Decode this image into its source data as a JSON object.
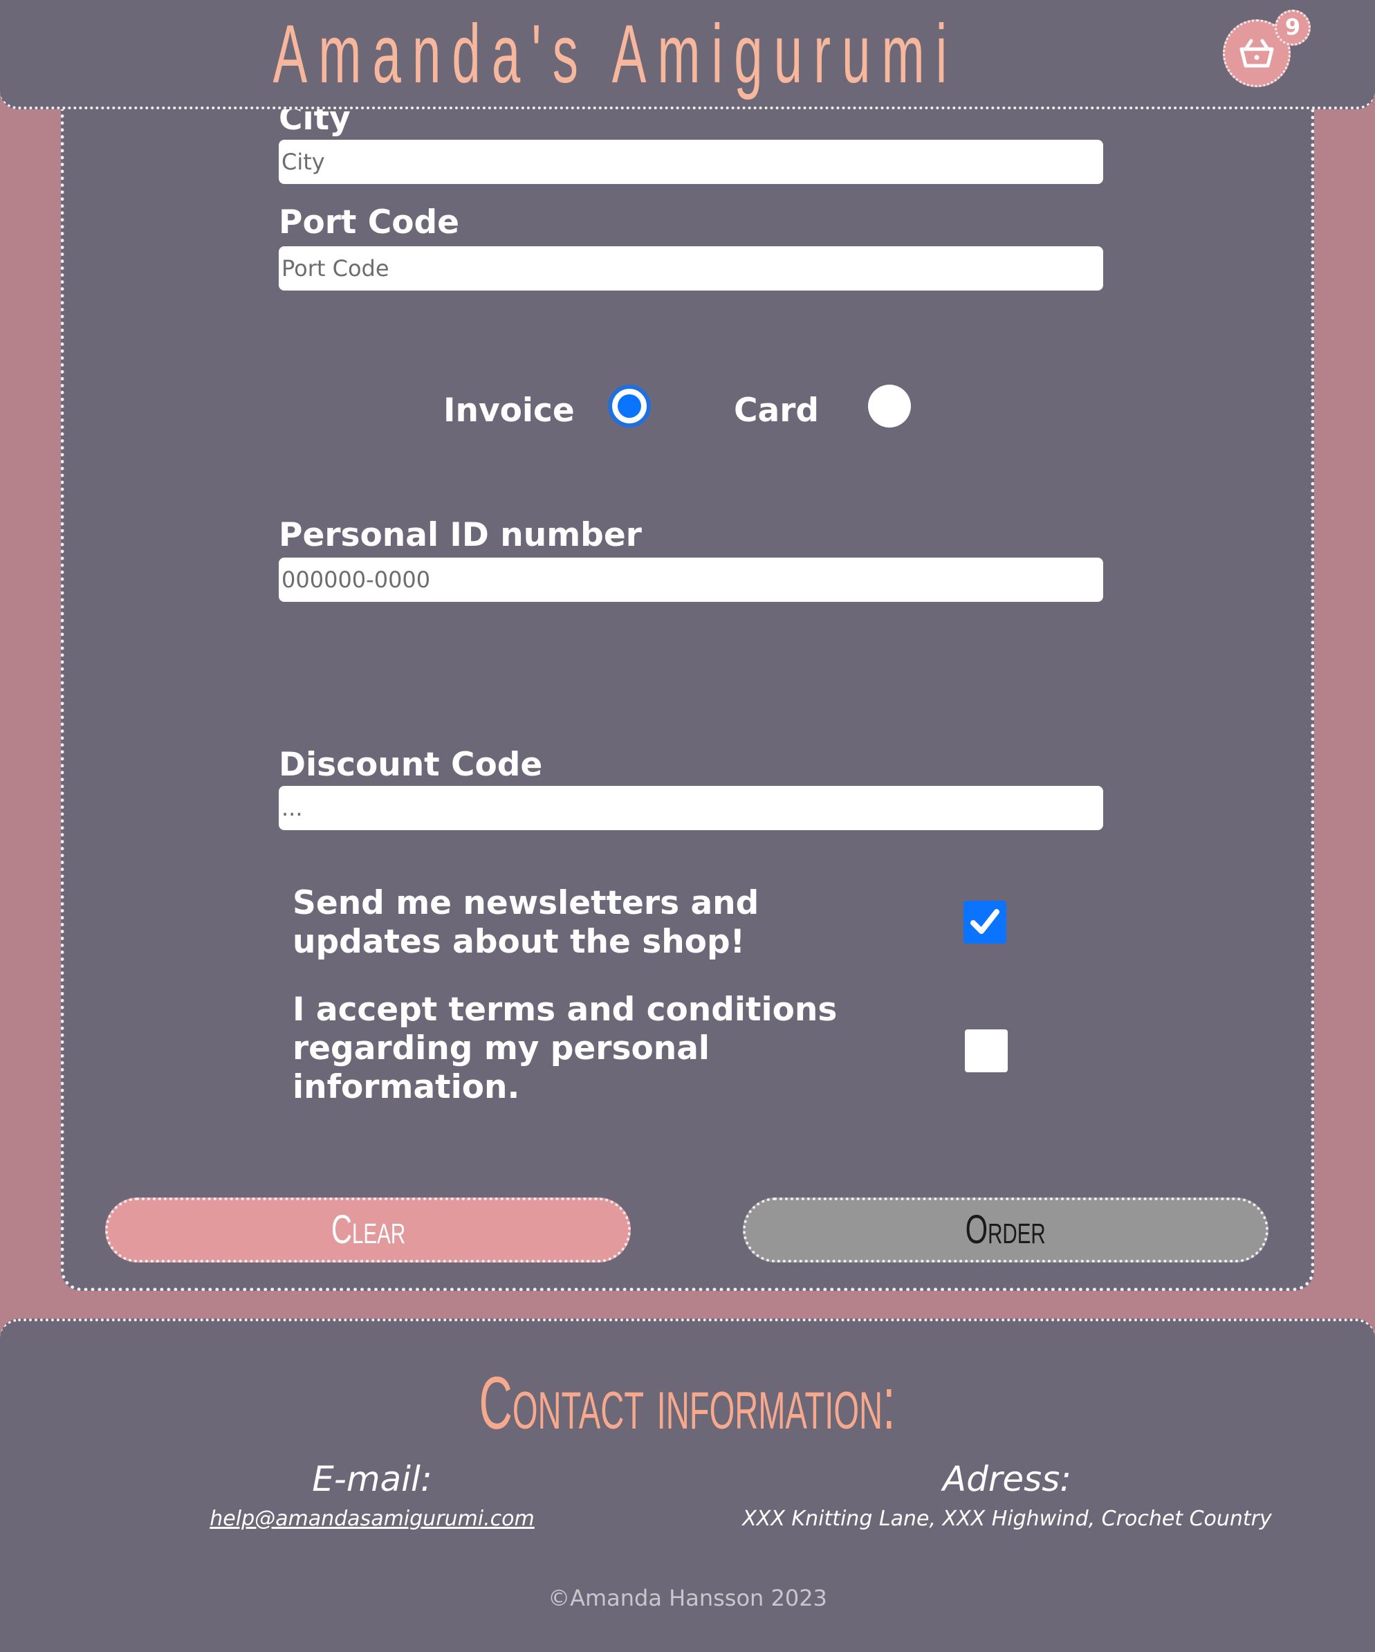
{
  "header": {
    "site_title": "Amanda's Amigurumi",
    "cart_count": "9"
  },
  "form": {
    "city": {
      "label": "City",
      "placeholder": "City"
    },
    "port_code": {
      "label": "Port Code",
      "placeholder": "Port Code"
    },
    "payment": {
      "options": [
        {
          "label": "Invoice",
          "selected": true
        },
        {
          "label": "Card",
          "selected": false
        }
      ]
    },
    "personal_id": {
      "label": "Personal ID number",
      "placeholder": "000000-0000"
    },
    "discount": {
      "label": "Discount Code",
      "placeholder": "..."
    },
    "newsletter": {
      "label": "Send me newsletters and updates about the shop!",
      "checked": true
    },
    "terms": {
      "label": "I accept terms and conditions regarding my personal information.",
      "checked": false
    },
    "buttons": {
      "clear": "Clear",
      "order": "Order"
    }
  },
  "footer": {
    "title": "Contact information:",
    "email_heading": "E-mail:",
    "email": "help@amandasamigurumi.com",
    "address_heading": "Adress:",
    "address": "XXX Knitting Lane, XXX Highwind, Crochet Country",
    "copyright": "©Amanda Hansson 2023"
  },
  "colors": {
    "background": "#b5828c",
    "panel": "#6c6877",
    "accent_pink": "#e29a9c",
    "title_peach": "#f7b79c",
    "checked_blue": "#0a74ff"
  },
  "icons": {
    "cart": "basket-icon",
    "check": "checkmark-icon"
  }
}
